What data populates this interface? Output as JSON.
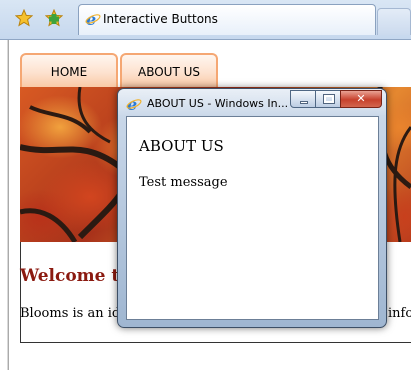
{
  "browser": {
    "tab_title": "Interactive Buttons",
    "icons": [
      "favorites-star-icon",
      "add-favorite-icon",
      "ie-icon"
    ]
  },
  "nav": {
    "home_label": "HOME",
    "about_label": "ABOUT US"
  },
  "content": {
    "welcome": "Welcome to",
    "body_start": "Blooms is an ide",
    "body_end": "info"
  },
  "popup": {
    "title": "ABOUT US - Windows In...",
    "heading": "ABOUT US",
    "message": "Test message",
    "close_glyph": "✕"
  },
  "colors": {
    "tab_border": "#f5a773",
    "welcome_text": "#8b1a10",
    "close_button": "#c7412c"
  }
}
